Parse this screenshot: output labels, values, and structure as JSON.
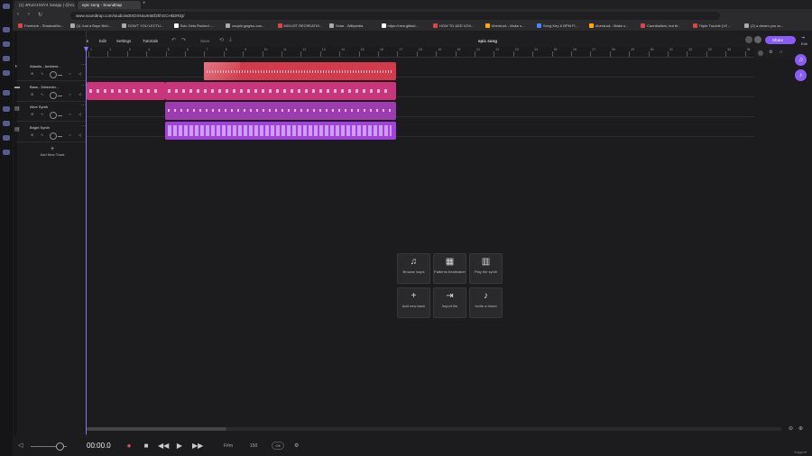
{
  "browser": {
    "tabs": [
      "(1) 4Runr1X6Y4 Swapp | @Vo...",
      "epic song - Soundtrap"
    ],
    "url": "www.soundtrap.com/studio/a0tXDXNxoK6Ef2hhGCHkDRtQ/",
    "bookmarks": [
      "Freeform - ShadowMo...",
      "(1) Just a Baye Brid...",
      "DON'T YOU LECTU...",
      "Solo Gets Rocked -...",
      "couple-gag/so-con...",
      "MIXLIST RECREATIO...",
      "Solar - Wikipedia",
      "https://new.github...",
      "HOW TO ADD VOX...",
      "Uberduck - Make s...",
      "Song Key & BPM Fi...",
      "Uberduck - Make c...",
      "Cannibalism, but th...",
      "Triple Trouble (V2 ...",
      "(2) a dream you ar..."
    ]
  },
  "app": {
    "menu": [
      "File",
      "Edit",
      "Settings",
      "Tutorials"
    ],
    "save_label": "Save",
    "project_title": "epic song",
    "share_label": "Share",
    "exit_label": "Exit"
  },
  "ruler": [
    "1",
    "2",
    "3",
    "4",
    "5",
    "6",
    "7",
    "8",
    "9",
    "10",
    "11",
    "12",
    "13",
    "14",
    "15",
    "16",
    "17",
    "18",
    "19",
    "20",
    "21",
    "22",
    "23",
    "24",
    "25",
    "26",
    "27",
    "28",
    "29",
    "30",
    "31",
    "32",
    "33",
    "34",
    "35"
  ],
  "tracks": [
    {
      "name": "Atlantis - Ambient...",
      "color": "#d33a4b"
    },
    {
      "name": "Bass - Determin...",
      "color": "#c9357a"
    },
    {
      "name": "Alive Synth",
      "color": "#9c3cae"
    },
    {
      "name": "Bright Synth",
      "color": "#a142dc"
    }
  ],
  "add_track_label": "Add New Track",
  "cards": [
    {
      "icon": "♫",
      "label": "Browse loops"
    },
    {
      "icon": "▦",
      "label": "Patterns beatmaker"
    },
    {
      "icon": "▥",
      "label": "Play the synth"
    },
    {
      "icon": "+",
      "label": "Add new track"
    },
    {
      "icon": "⇥",
      "label": "Import file"
    },
    {
      "icon": "♪",
      "label": "Invite a friend"
    }
  ],
  "transport": {
    "time": "00:00.0",
    "key": "F#m",
    "tempo": "150",
    "metronome": "Off"
  },
  "support_label": "Support"
}
